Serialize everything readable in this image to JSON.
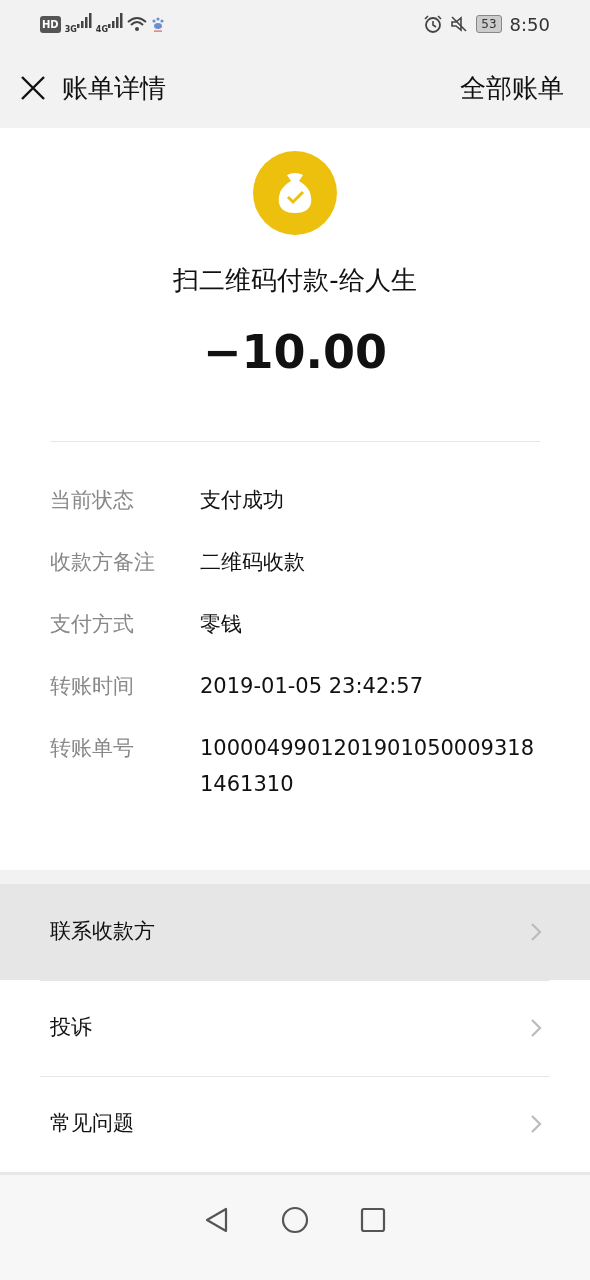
{
  "status_bar": {
    "hd": "HD",
    "networks": [
      "3G",
      "4G"
    ],
    "battery": "53",
    "time": "8:50"
  },
  "header": {
    "title": "账单详情",
    "action": "全部账单"
  },
  "summary": {
    "title": "扫二维码付款-给人生",
    "amount": "−10.00"
  },
  "details": [
    {
      "label": "当前状态",
      "value": "支付成功"
    },
    {
      "label": "收款方备注",
      "value": "二维码收款"
    },
    {
      "label": "支付方式",
      "value": "零钱"
    },
    {
      "label": "转账时间",
      "value": "2019-01-05 23:42:57"
    },
    {
      "label": "转账单号",
      "value": "10000499012019010500093181461310"
    }
  ],
  "menu": [
    {
      "label": "联系收款方",
      "selected": true
    },
    {
      "label": "投诉",
      "selected": false
    },
    {
      "label": "常见问题",
      "selected": false
    }
  ]
}
